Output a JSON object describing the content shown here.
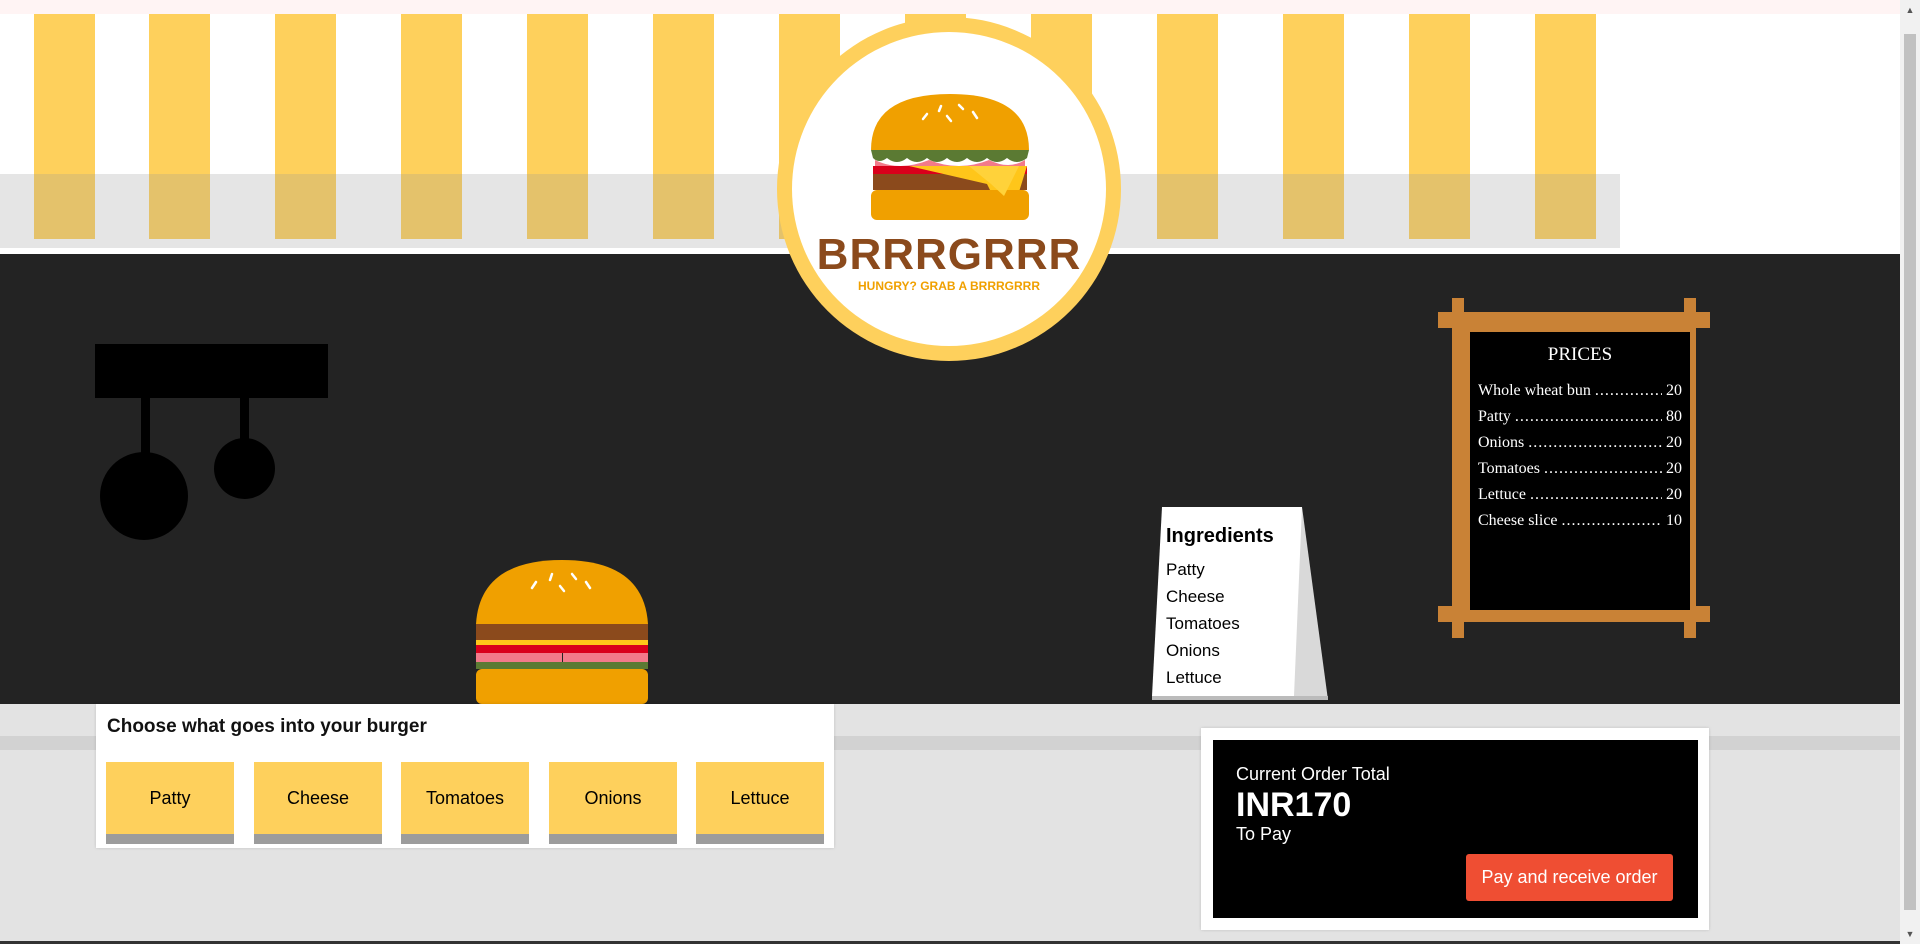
{
  "brand": {
    "name": "BRRRGRRR",
    "tagline": "HUNGRY? GRAB A BRRRGRRR"
  },
  "price_board": {
    "title": "PRICES",
    "items": [
      {
        "name": "Whole wheat bun",
        "price": "20"
      },
      {
        "name": "Patty",
        "price": "80"
      },
      {
        "name": "Onions",
        "price": "20"
      },
      {
        "name": "Tomatoes",
        "price": "20"
      },
      {
        "name": "Lettuce",
        "price": "20"
      },
      {
        "name": "Cheese slice",
        "price": "10"
      }
    ]
  },
  "ingredients_sign": {
    "title": "Ingredients",
    "items": [
      "Patty",
      "Cheese",
      "Tomatoes",
      "Onions",
      "Lettuce"
    ]
  },
  "chooser": {
    "title": "Choose what goes into your burger",
    "buttons": [
      "Patty",
      "Cheese",
      "Tomatoes",
      "Onions",
      "Lettuce"
    ]
  },
  "order": {
    "label": "Current Order Total",
    "amount": "INR170",
    "to_pay": "To Pay",
    "pay_button": "Pay and receive order"
  },
  "colors": {
    "awning_yellow": "#fed05c",
    "wall": "#232323",
    "bun": "#f0a000",
    "frame": "#c98236",
    "pay_button": "#ef4e33"
  }
}
